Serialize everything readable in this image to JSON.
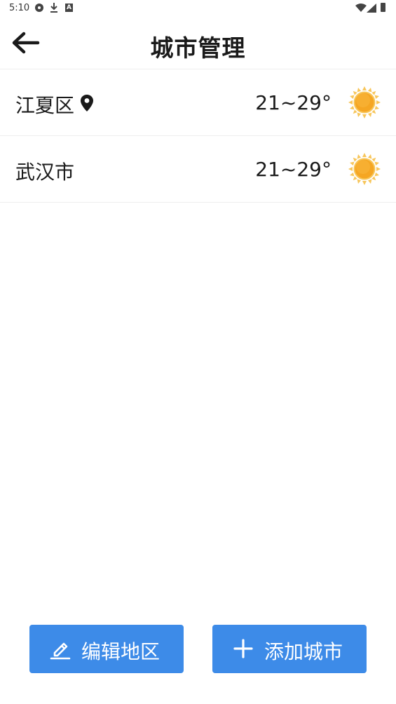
{
  "status_bar": {
    "time": "5:10",
    "download_icon": "download-icon",
    "accessibility_icon": "A"
  },
  "header": {
    "title": "城市管理",
    "back_icon": "arrow-left-icon"
  },
  "cities": [
    {
      "name": "江夏区",
      "temp": "21~29°",
      "is_location": true,
      "weather_icon": "sun-icon"
    },
    {
      "name": "武汉市",
      "temp": "21~29°",
      "is_location": false,
      "weather_icon": "sun-icon"
    }
  ],
  "actions": {
    "edit_label": "编辑地区",
    "add_label": "添加城市"
  },
  "colors": {
    "accent": "#3d8be8",
    "sun": "#f5a623",
    "divider": "#eeeeee"
  }
}
